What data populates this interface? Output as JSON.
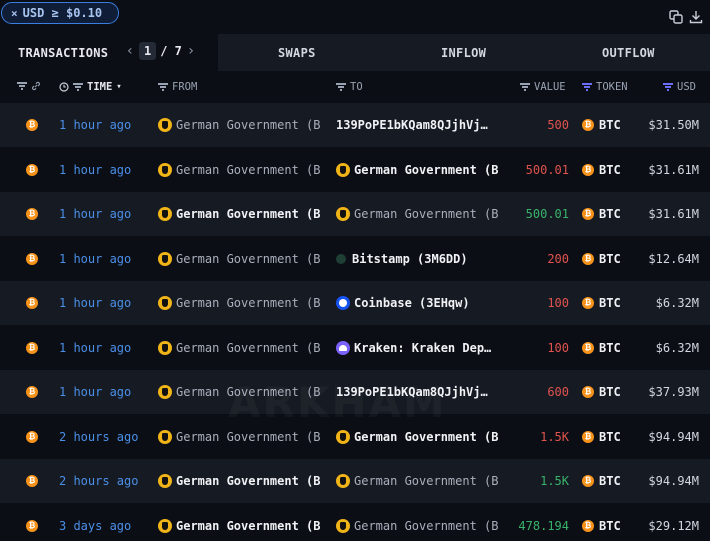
{
  "filter_chip": {
    "close": "×",
    "label": "USD ≥ $0.10"
  },
  "tabs": {
    "transactions": "TRANSACTIONS",
    "page_current": "1",
    "page_total": "/ 7",
    "prev_arrow": "‹",
    "next_arrow": "›",
    "swaps": "SWAPS",
    "inflow": "INFLOW",
    "outflow": "OUTFLOW"
  },
  "columns": {
    "time": "TIME",
    "time_sort": "▾",
    "from": "FROM",
    "to": "TO",
    "value": "VALUE",
    "token": "TOKEN",
    "usd": "USD"
  },
  "watermark": "ARKHAM",
  "rows": [
    {
      "time": "1 hour ago",
      "from": "German Government (B",
      "from_bold": false,
      "from_logo": "german-government",
      "to": "139PoPE1bKQam8QJjhVj…",
      "to_bold": true,
      "to_logo": "",
      "value": "500",
      "value_color": "red",
      "token": "BTC",
      "usd": "$31.50M"
    },
    {
      "time": "1 hour ago",
      "from": "German Government (B",
      "from_bold": false,
      "from_logo": "german-government",
      "to": "German Government (B",
      "to_bold": true,
      "to_logo": "german-government",
      "value": "500.01",
      "value_color": "red",
      "token": "BTC",
      "usd": "$31.61M"
    },
    {
      "time": "1 hour ago",
      "from": "German Government (B",
      "from_bold": true,
      "from_logo": "german-government",
      "to": "German Government (B",
      "to_bold": false,
      "to_logo": "german-government",
      "value": "500.01",
      "value_color": "green",
      "token": "BTC",
      "usd": "$31.61M"
    },
    {
      "time": "1 hour ago",
      "from": "German Government (B",
      "from_bold": false,
      "from_logo": "german-government",
      "to": "Bitstamp (3M6DD)",
      "to_bold": true,
      "to_logo": "bitstamp",
      "value": "200",
      "value_color": "red",
      "token": "BTC",
      "usd": "$12.64M"
    },
    {
      "time": "1 hour ago",
      "from": "German Government (B",
      "from_bold": false,
      "from_logo": "german-government",
      "to": "Coinbase (3EHqw)",
      "to_bold": true,
      "to_logo": "coinbase",
      "value": "100",
      "value_color": "red",
      "token": "BTC",
      "usd": "$6.32M"
    },
    {
      "time": "1 hour ago",
      "from": "German Government (B",
      "from_bold": false,
      "from_logo": "german-government",
      "to": "Kraken: Kraken Dep…",
      "to_bold": true,
      "to_logo": "kraken",
      "value": "100",
      "value_color": "red",
      "token": "BTC",
      "usd": "$6.32M"
    },
    {
      "time": "1 hour ago",
      "from": "German Government (B",
      "from_bold": false,
      "from_logo": "german-government",
      "to": "139PoPE1bKQam8QJjhVj…",
      "to_bold": true,
      "to_logo": "",
      "value": "600",
      "value_color": "red",
      "token": "BTC",
      "usd": "$37.93M"
    },
    {
      "time": "2 hours ago",
      "from": "German Government (B",
      "from_bold": false,
      "from_logo": "german-government",
      "to": "German Government (B",
      "to_bold": true,
      "to_logo": "german-government",
      "value": "1.5K",
      "value_color": "red",
      "token": "BTC",
      "usd": "$94.94M"
    },
    {
      "time": "2 hours ago",
      "from": "German Government (B",
      "from_bold": true,
      "from_logo": "german-government",
      "to": "German Government (B",
      "to_bold": false,
      "to_logo": "german-government",
      "value": "1.5K",
      "value_color": "green",
      "token": "BTC",
      "usd": "$94.94M"
    },
    {
      "time": "3 days ago",
      "from": "German Government (B",
      "from_bold": true,
      "from_logo": "german-government",
      "to": "German Government (B",
      "to_bold": false,
      "to_logo": "german-government",
      "value": "478.194",
      "value_color": "green",
      "token": "BTC",
      "usd": "$29.12M"
    }
  ],
  "colors": {
    "accent": "#3a7ee0",
    "time_link": "#4a8fe8",
    "value_out": "#e0534f",
    "value_in": "#39b36b",
    "btc": "#f7931a",
    "token_filter": "#6b6ef5"
  }
}
